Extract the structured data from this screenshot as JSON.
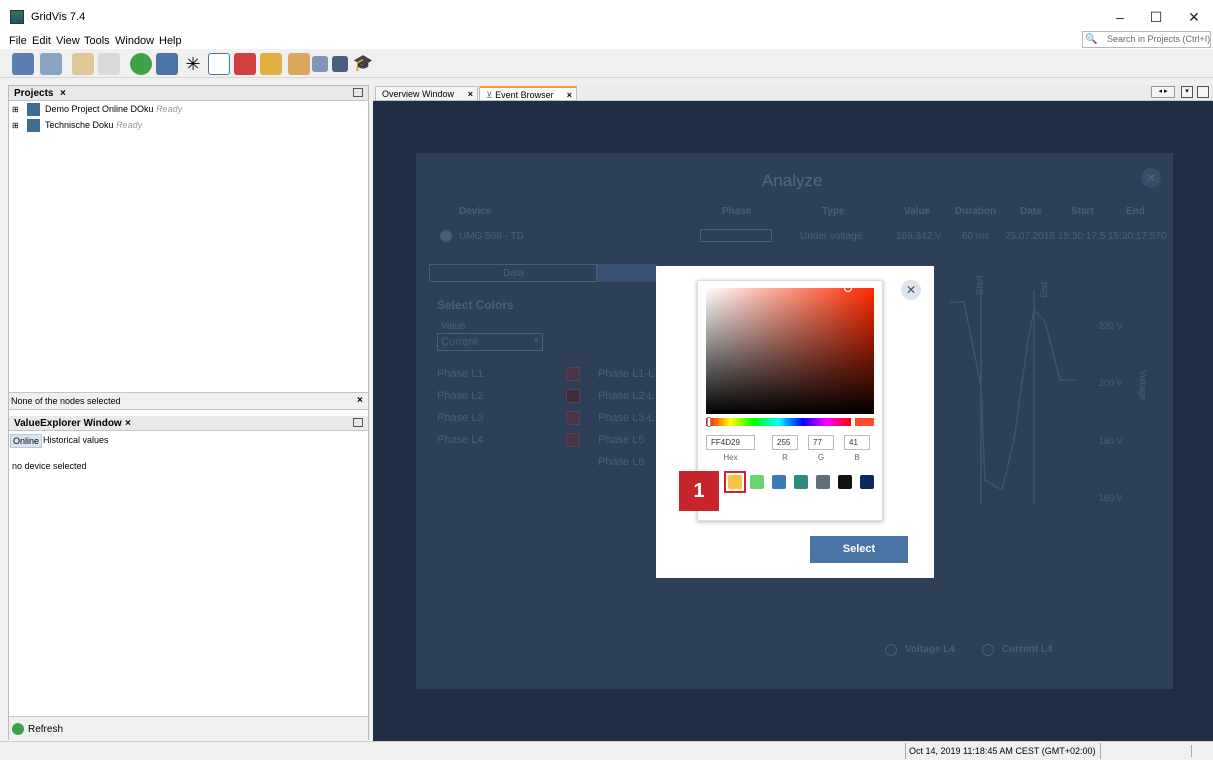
{
  "window": {
    "title": "GridVis 7.4",
    "minimize": "–",
    "maximize": "☐",
    "close": "✕"
  },
  "menu": [
    "File",
    "Edit",
    "View",
    "Tools",
    "Window",
    "Help"
  ],
  "search": {
    "placeholder": "Search in Projects (Ctrl+I)"
  },
  "projects": {
    "tab": "Projects",
    "items": [
      {
        "name": "Demo Project Online DOku",
        "status": "Ready"
      },
      {
        "name": "Technische Doku",
        "status": "Ready"
      }
    ],
    "footer": "None of the nodes selected"
  },
  "value_explorer": {
    "tab": "ValueExplorer Window",
    "tabs": [
      "Online",
      "Historical values"
    ],
    "message": "no device selected",
    "refresh": "Refresh"
  },
  "editor_tabs": [
    "Overview Window",
    "Event Browser"
  ],
  "analyze": {
    "title": "Analyze",
    "columns": [
      "Device",
      "Phase",
      "Type",
      "Value",
      "Duration",
      "Date",
      "Start",
      "End"
    ],
    "row": {
      "device": "UMG 508 - TD",
      "type": "Under voltage",
      "value": "169.342 V",
      "duration": "60 ms",
      "date": "25.07.2018",
      "start": "15:30:17.5",
      "end": "15:30:17:570"
    },
    "tabs": [
      "Data"
    ],
    "select_colors": "Select Colors",
    "value_label": "Value",
    "value_select": "Current",
    "phases_left": [
      "Phase L1",
      "Phase L2",
      "Phase L3",
      "Phase L4"
    ],
    "phases_right": [
      "Phase L1-L",
      "Phase L2-L",
      "Phase L3-L",
      "Phase L5",
      "Phase L6"
    ],
    "y_labels": [
      "220 V",
      "200 V",
      "180 V",
      "160 V"
    ],
    "axis_label": "Voltage",
    "markers": [
      "Start",
      "End"
    ],
    "legend": [
      "Voltage L4",
      "Current L4"
    ]
  },
  "color_picker": {
    "hex": "FF4D29",
    "r": "255",
    "g": "77",
    "b": "41",
    "labels": {
      "hex": "Hex",
      "r": "R",
      "g": "G",
      "b": "B"
    },
    "swatches": [
      "#f5c242",
      "#6dd46d",
      "#3e7bb6",
      "#2e8a7a",
      "#5f6e7a",
      "#111111",
      "#0d2a5e"
    ],
    "select": "Select",
    "close": "✕"
  },
  "annotation": {
    "number": "1"
  },
  "status": {
    "datetime": "Oct 14, 2019 11:18:45 AM CEST (GMT+02:00)"
  }
}
